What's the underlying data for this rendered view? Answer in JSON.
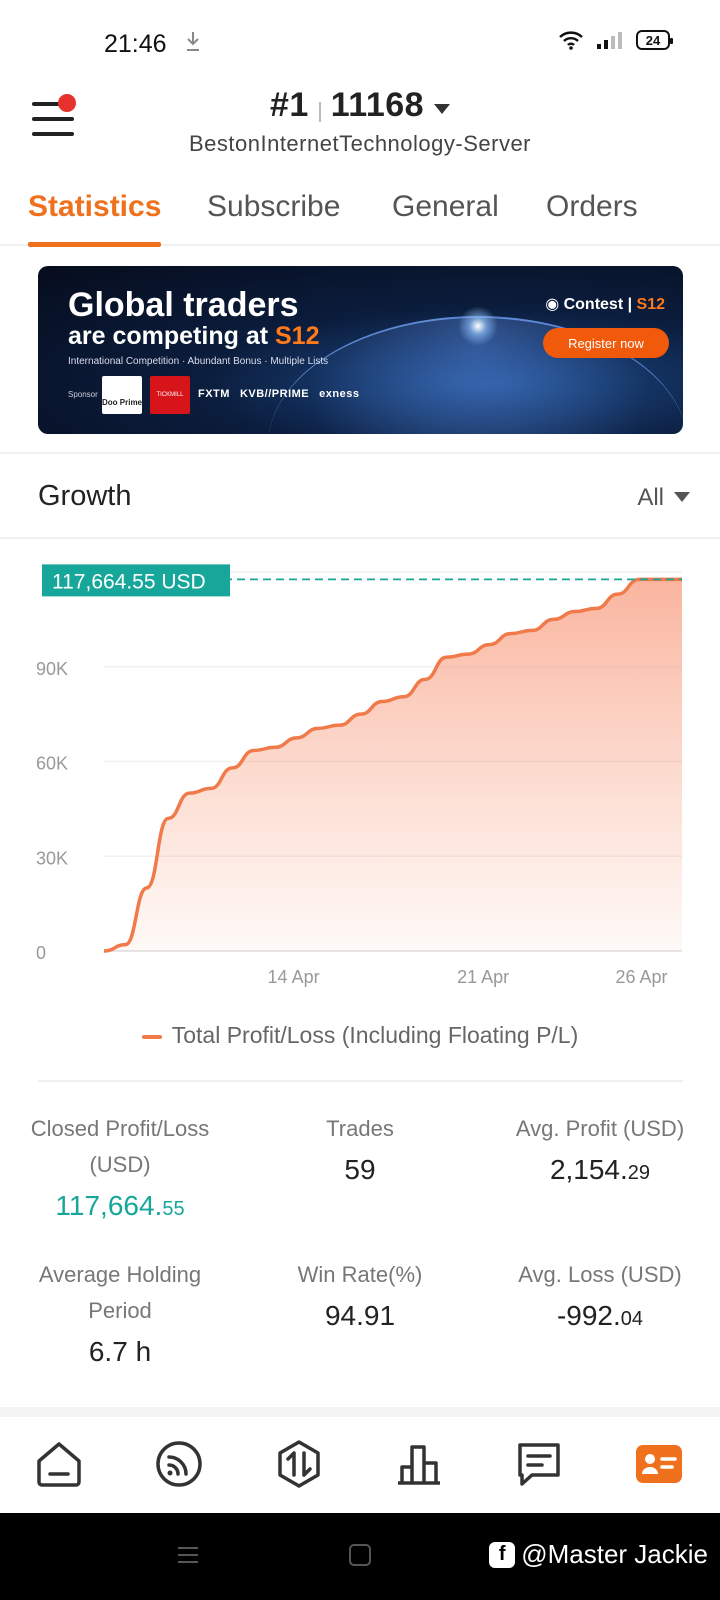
{
  "status_bar": {
    "time": "21:46",
    "battery": "24"
  },
  "header": {
    "account_rank": "#1",
    "account_id": "11168",
    "server": "BestonInternetTechnology-Server"
  },
  "tabs": [
    {
      "label": "Statistics",
      "active": true
    },
    {
      "label": "Subscribe",
      "active": false
    },
    {
      "label": "General",
      "active": false
    },
    {
      "label": "Orders",
      "active": false
    }
  ],
  "banner": {
    "headline": "Global traders",
    "subheadline_pre": "are competing at ",
    "subheadline_brand": "S12",
    "sub": "International Competition · Abundant Bonus · Multiple Lists",
    "contest": "Contest",
    "contest_brand": "S12",
    "register": "Register now",
    "sponsor": "Sponsor",
    "sponsor_logo1": "Doo Prime",
    "sponsor_logo2": "TICKMILL",
    "brands": [
      "FXTM",
      "KVB//PRIME",
      "exness"
    ]
  },
  "growth": {
    "title": "Growth",
    "filter": "All"
  },
  "chart_data": {
    "type": "area",
    "current_label": "117,664.55 USD",
    "y_ticks": [
      "0",
      "30K",
      "60K",
      "90K"
    ],
    "ylim": [
      0,
      120000
    ],
    "x_ticks": [
      "14 Apr",
      "21 Apr",
      "26 Apr"
    ],
    "series": [
      {
        "name": "Total Profit/Loss (Including Floating P/L)",
        "values": [
          0,
          2000,
          20000,
          42000,
          50000,
          51500,
          58000,
          63500,
          64500,
          67500,
          70500,
          71500,
          75000,
          79000,
          80500,
          86000,
          93000,
          94000,
          97000,
          100500,
          101500,
          105000,
          107500,
          108500,
          113000,
          117664.55,
          117664.55,
          117664.55
        ]
      }
    ],
    "color": "#f07a4a"
  },
  "stats": {
    "closed_pl": {
      "label_line1": "Closed Profit/Loss",
      "label_line2": "(USD)",
      "value_main": "117,664.",
      "value_dec": "55"
    },
    "trades": {
      "label": "Trades",
      "value": "59"
    },
    "avg_profit": {
      "label": "Avg. Profit (USD)",
      "value_main": "2,154.",
      "value_dec": "29"
    },
    "avg_holding": {
      "label_line1": "Average Holding",
      "label_line2": "Period",
      "value": "6.7 h"
    },
    "win_rate": {
      "label": "Win Rate(%)",
      "value": "94.91"
    },
    "avg_loss": {
      "label": "Avg. Loss (USD)",
      "value_main": "-992.",
      "value_dec": "04"
    }
  },
  "watermark": "@Master Jackie",
  "colors": {
    "accent": "#f0711d",
    "green": "#17a79a"
  }
}
